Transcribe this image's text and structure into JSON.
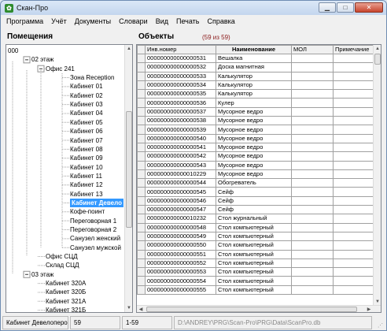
{
  "window": {
    "title": "Скан-Про",
    "app_icon": "app-leaf-icon",
    "controls": [
      "minimize",
      "maximize",
      "close"
    ]
  },
  "menu": [
    "Программа",
    "Учёт",
    "Документы",
    "Словари",
    "Вид",
    "Печать",
    "Справка"
  ],
  "left_panel": {
    "title": "Помещения",
    "tree": [
      {
        "label": "000",
        "level": 0,
        "expander": "",
        "selected": false
      },
      {
        "label": "02 этаж",
        "level": 1,
        "expander": "-",
        "selected": false
      },
      {
        "label": "Офис 241",
        "level": 2,
        "expander": "-",
        "selected": false
      },
      {
        "label": "Зона Reception",
        "level": 3,
        "expander": "",
        "selected": false
      },
      {
        "label": "Кабинет 01",
        "level": 3,
        "expander": "",
        "selected": false
      },
      {
        "label": "Кабинет 02",
        "level": 3,
        "expander": "",
        "selected": false
      },
      {
        "label": "Кабинет 03",
        "level": 3,
        "expander": "",
        "selected": false
      },
      {
        "label": "Кабинет 04",
        "level": 3,
        "expander": "",
        "selected": false
      },
      {
        "label": "Кабинет 05",
        "level": 3,
        "expander": "",
        "selected": false
      },
      {
        "label": "Кабинет 06",
        "level": 3,
        "expander": "",
        "selected": false
      },
      {
        "label": "Кабинет 07",
        "level": 3,
        "expander": "",
        "selected": false
      },
      {
        "label": "Кабинет 08",
        "level": 3,
        "expander": "",
        "selected": false
      },
      {
        "label": "Кабинет 09",
        "level": 3,
        "expander": "",
        "selected": false
      },
      {
        "label": "Кабинет 10",
        "level": 3,
        "expander": "",
        "selected": false
      },
      {
        "label": "Кабинет 11",
        "level": 3,
        "expander": "",
        "selected": false
      },
      {
        "label": "Кабинет 12",
        "level": 3,
        "expander": "",
        "selected": false
      },
      {
        "label": "Кабинет 13",
        "level": 3,
        "expander": "",
        "selected": false
      },
      {
        "label": "Кабинет Девело",
        "level": 3,
        "expander": "",
        "selected": true
      },
      {
        "label": "Кофе-поинт",
        "level": 3,
        "expander": "",
        "selected": false
      },
      {
        "label": "Переговорная 1",
        "level": 3,
        "expander": "",
        "selected": false
      },
      {
        "label": "Переговорная 2",
        "level": 3,
        "expander": "",
        "selected": false
      },
      {
        "label": "Санузел женский",
        "level": 3,
        "expander": "",
        "selected": false
      },
      {
        "label": "Санузел мужской",
        "level": 3,
        "expander": "",
        "selected": false
      },
      {
        "label": "Офис СЦД",
        "level": 2,
        "expander": "",
        "selected": false
      },
      {
        "label": "Склад СЦД",
        "level": 2,
        "expander": "",
        "selected": false
      },
      {
        "label": "03 этаж",
        "level": 1,
        "expander": "-",
        "selected": false
      },
      {
        "label": "Кабинет 320А",
        "level": 2,
        "expander": "",
        "selected": false
      },
      {
        "label": "Кабинет 320Б",
        "level": 2,
        "expander": "",
        "selected": false
      },
      {
        "label": "Кабинет 321А",
        "level": 2,
        "expander": "",
        "selected": false
      },
      {
        "label": "Кабинет 321Б",
        "level": 2,
        "expander": "",
        "selected": false
      }
    ]
  },
  "right_panel": {
    "title": "Объекты",
    "count": "(59 из 59)",
    "columns": [
      "Инв.номер",
      "Наименование",
      "МОЛ",
      "Примечание"
    ],
    "rows": [
      [
        "000000000000000531",
        "Вешалка",
        "",
        ""
      ],
      [
        "000000000000000532",
        "Доска магнитная",
        "",
        ""
      ],
      [
        "000000000000000533",
        "Калькулятор",
        "",
        ""
      ],
      [
        "000000000000000534",
        "Калькулятор",
        "",
        ""
      ],
      [
        "000000000000000535",
        "Калькулятор",
        "",
        ""
      ],
      [
        "000000000000000536",
        "Кулер",
        "",
        ""
      ],
      [
        "000000000000000537",
        "Мусорное ведро",
        "",
        ""
      ],
      [
        "000000000000000538",
        "Мусорное ведро",
        "",
        ""
      ],
      [
        "000000000000000539",
        "Мусорное ведро",
        "",
        ""
      ],
      [
        "000000000000000540",
        "Мусорное ведро",
        "",
        ""
      ],
      [
        "000000000000000541",
        "Мусорное ведро",
        "",
        ""
      ],
      [
        "000000000000000542",
        "Мусорное ведро",
        "",
        ""
      ],
      [
        "000000000000000543",
        "Мусорное ведро",
        "",
        ""
      ],
      [
        "000000000000010229",
        "Мусорное ведро",
        "",
        ""
      ],
      [
        "000000000000000544",
        "Обогреватель",
        "",
        ""
      ],
      [
        "000000000000000545",
        "Сейф",
        "",
        ""
      ],
      [
        "000000000000000546",
        "Сейф",
        "",
        ""
      ],
      [
        "000000000000000547",
        "Сейф",
        "",
        ""
      ],
      [
        "000000000000010232",
        "Стол журнальный",
        "",
        ""
      ],
      [
        "000000000000000548",
        "Стол компьютерный",
        "",
        ""
      ],
      [
        "000000000000000549",
        "Стол компьютерный",
        "",
        ""
      ],
      [
        "000000000000000550",
        "Стол компьютерный",
        "",
        ""
      ],
      [
        "000000000000000551",
        "Стол компьютерный",
        "",
        ""
      ],
      [
        "000000000000000552",
        "Стол компьютерный",
        "",
        ""
      ],
      [
        "000000000000000553",
        "Стол компьютерный",
        "",
        ""
      ],
      [
        "000000000000000554",
        "Стол компьютерный",
        "",
        ""
      ],
      [
        "000000000000000555",
        "Стол компьютерный",
        "",
        ""
      ]
    ]
  },
  "status": {
    "room": "Кабинет Девелоперов",
    "count": "59",
    "range": "1-59",
    "path": "D:\\ANDREY\\PRG\\Scan-Pro\\PRG\\Data\\ScanPro.db"
  }
}
